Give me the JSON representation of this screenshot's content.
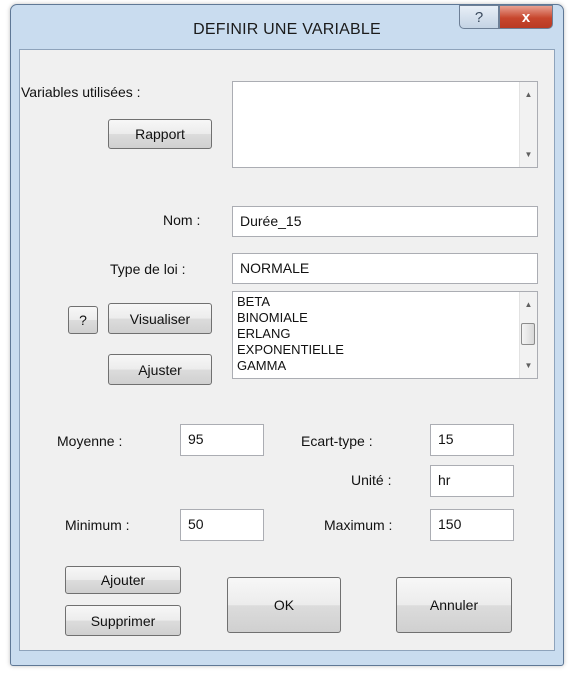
{
  "window": {
    "title": "DEFINIR UNE VARIABLE",
    "help_glyph": "?",
    "close_glyph": "x"
  },
  "variables": {
    "label": "Variables utilisées :",
    "report_button": "Rapport",
    "items": []
  },
  "form": {
    "name_label": "Nom :",
    "name_value": "Durée_15",
    "law_type_label": "Type de loi :",
    "law_type_value": "NORMALE"
  },
  "distribution": {
    "help_button": "?",
    "view_button": "Visualiser",
    "fit_button": "Ajuster",
    "options": [
      "BETA",
      "BINOMIALE",
      "ERLANG",
      "EXPONENTIELLE",
      "GAMMA"
    ]
  },
  "params": {
    "mean_label": "Moyenne :",
    "mean_value": "95",
    "stddev_label": "Ecart-type :",
    "stddev_value": "15",
    "unit_label": "Unité :",
    "unit_value": "hr",
    "min_label": "Minimum :",
    "min_value": "50",
    "max_label": "Maximum :",
    "max_value": "150"
  },
  "actions": {
    "add": "Ajouter",
    "delete": "Supprimer",
    "ok": "OK",
    "cancel": "Annuler"
  },
  "colors": {
    "window_frame": "#c9dcef",
    "close_button": "#c7462d",
    "client_background": "#f0f0f0"
  }
}
